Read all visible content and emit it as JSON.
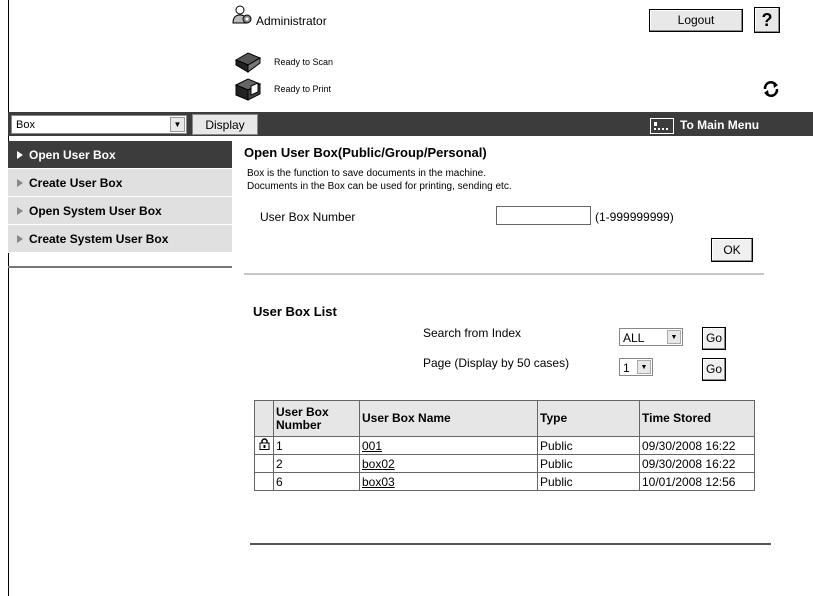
{
  "header": {
    "user_label": "Administrator",
    "logout_label": "Logout",
    "help_label": "?",
    "status": [
      {
        "text": "Ready to Scan",
        "icon": "scanner-icon"
      },
      {
        "text": "Ready to Print",
        "icon": "printer-icon"
      }
    ]
  },
  "toolbar": {
    "select_value": "Box",
    "display_label": "Display",
    "main_menu_label": "To Main Menu"
  },
  "sidebar": {
    "items": [
      {
        "label": "Open User Box",
        "active": true
      },
      {
        "label": "Create User Box",
        "active": false
      },
      {
        "label": "Open System User Box",
        "active": false
      },
      {
        "label": "Create System User Box",
        "active": false
      }
    ]
  },
  "open_box": {
    "title": "Open User Box(Public/Group/Personal)",
    "desc1": "Box is the function to save documents in the machine.",
    "desc2": "Documents in the Box can be used for printing, sending etc.",
    "number_label": "User Box Number",
    "number_value": "",
    "range": "(1-999999999)",
    "ok_label": "OK"
  },
  "list": {
    "title": "User Box List",
    "search_label": "Search from Index",
    "search_value": "ALL",
    "page_label": "Page (Display by 50 cases)",
    "page_value": "1",
    "go_label": "Go",
    "columns": [
      "User Box Number",
      "User Box Name",
      "Type",
      "Time Stored"
    ],
    "rows": [
      {
        "locked": true,
        "number": "1",
        "name": "001",
        "type": "Public",
        "time": "09/30/2008 16:22"
      },
      {
        "locked": false,
        "number": "2",
        "name": "box02",
        "type": "Public",
        "time": "09/30/2008 16:22"
      },
      {
        "locked": false,
        "number": "6",
        "name": "box03",
        "type": "Public",
        "time": "10/01/2008 12:56"
      }
    ]
  },
  "colors": {
    "dark_bar": "#3c3c3c",
    "sidebar_bg": "#e0e0e0"
  }
}
